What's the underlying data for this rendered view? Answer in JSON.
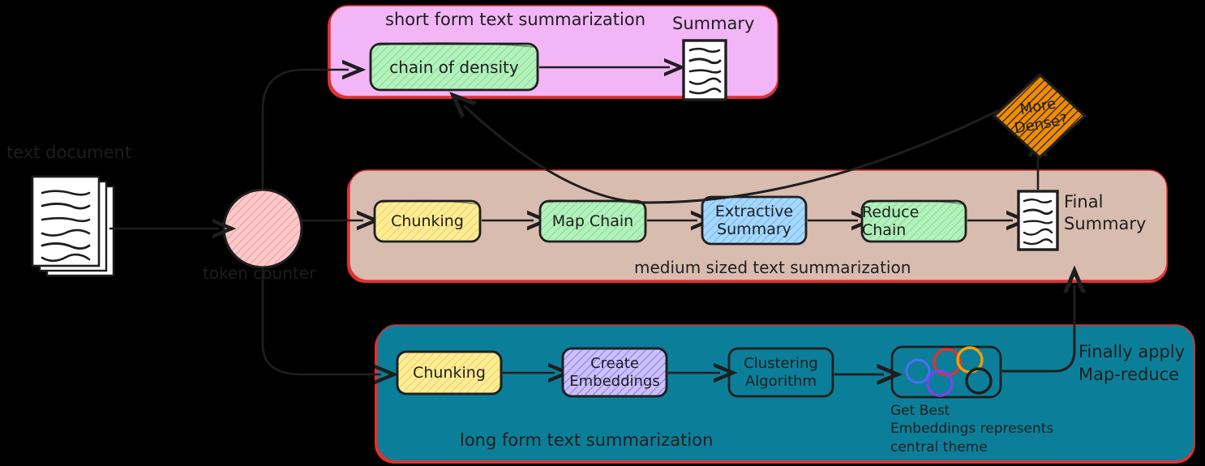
{
  "diagram": {
    "title": "text summarization routing pipeline",
    "background": "#000000",
    "stroke": "#1e1e1e",
    "panel_border": "#e03131"
  },
  "source": {
    "label": "text document",
    "label_color": "#1e1e1e"
  },
  "router": {
    "label": "token counter",
    "fill": "#ffc9c9",
    "hatch": true
  },
  "panels": [
    {
      "id": "short",
      "caption": "short form text summarization",
      "fill": "#f2b6f7",
      "border": "#e03131"
    },
    {
      "id": "medium",
      "caption": "medium sized text summarization",
      "fill": "#d8bcb0",
      "border": "#e03131"
    },
    {
      "id": "long",
      "caption": "long form text summarization",
      "fill": "#0b7f99",
      "border": "#e03131"
    }
  ],
  "short_form": {
    "node": {
      "label": "chain of density",
      "fill": "#b2f2bb",
      "hatch": true
    },
    "output": {
      "label": "Summary"
    }
  },
  "medium_form": {
    "nodes": [
      {
        "label": "Chunking",
        "fill": "#ffec99",
        "hatch": true
      },
      {
        "label": "Map Chain",
        "fill": "#b2f2bb",
        "hatch": true
      },
      {
        "label": "Extractive Summary",
        "line1": "Extractive",
        "line2": "Summary",
        "fill": "#a5d8ff",
        "hatch": true
      },
      {
        "label": "Reduce Chain",
        "fill": "#b2f2bb",
        "hatch": true
      }
    ],
    "output": {
      "line1": "Final",
      "line2": "Summary"
    }
  },
  "long_form": {
    "nodes": [
      {
        "label": "Chunking",
        "fill": "#ffec99",
        "hatch": true
      },
      {
        "label": "Create Embeddings",
        "line1": "Create",
        "line2": "Embeddings",
        "fill": "#d0bfff",
        "hatch": true
      },
      {
        "label": "Clustering Algorithm",
        "line1": "Clustering",
        "line2": "Algorithm",
        "fill": "transparent",
        "hatch": false
      }
    ],
    "clusters": {
      "caption_line1": "Get Best",
      "caption_line2": "Embeddings represents",
      "caption_line3": "central theme",
      "circle_colors": [
        "#4c6ef5",
        "#e03131",
        "#f59f00",
        "#7048e8",
        "#1e1e1e"
      ]
    },
    "feedback_label_line1": "Finally apply",
    "feedback_label_line2": "Map-reduce"
  },
  "decision": {
    "line1": "More",
    "line2": "Dense?",
    "fill": "#f08c00",
    "hatch": true
  }
}
